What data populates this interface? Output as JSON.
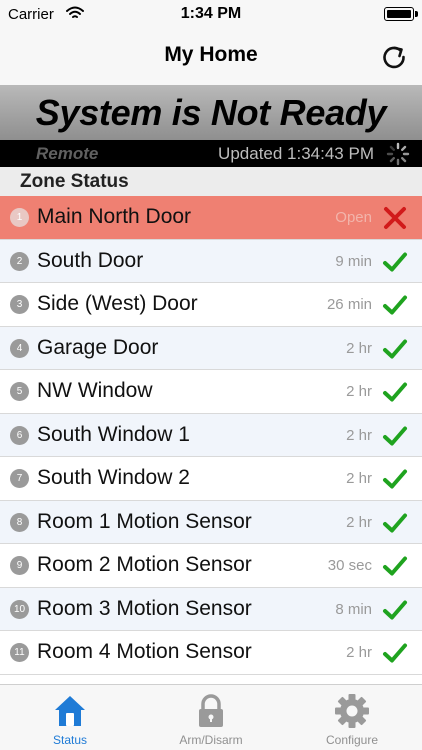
{
  "status_bar": {
    "carrier": "Carrier",
    "time": "1:34 PM"
  },
  "nav": {
    "title": "My Home",
    "refresh_icon": "refresh-icon"
  },
  "banner": {
    "text": "System is Not Ready",
    "color": "#000000"
  },
  "info": {
    "mode": "Remote",
    "updated": "Updated 1:34:43 PM"
  },
  "section": {
    "title": "Zone Status"
  },
  "zones": [
    {
      "num": "1",
      "name": "Main North Door",
      "time": "Open",
      "state": "alarm"
    },
    {
      "num": "2",
      "name": "South Door",
      "time": "9 min",
      "state": "ok"
    },
    {
      "num": "3",
      "name": "Side (West) Door",
      "time": "26 min",
      "state": "ok"
    },
    {
      "num": "4",
      "name": "Garage Door",
      "time": "2 hr",
      "state": "ok"
    },
    {
      "num": "5",
      "name": "NW Window",
      "time": "2 hr",
      "state": "ok"
    },
    {
      "num": "6",
      "name": "South Window 1",
      "time": "2 hr",
      "state": "ok"
    },
    {
      "num": "7",
      "name": "South Window 2",
      "time": "2 hr",
      "state": "ok"
    },
    {
      "num": "8",
      "name": "Room 1 Motion Sensor",
      "time": "2 hr",
      "state": "ok"
    },
    {
      "num": "9",
      "name": "Room 2 Motion Sensor",
      "time": "30 sec",
      "state": "ok"
    },
    {
      "num": "10",
      "name": "Room 3 Motion Sensor",
      "time": "8 min",
      "state": "ok"
    },
    {
      "num": "11",
      "name": "Room 4 Motion Sensor",
      "time": "2 hr",
      "state": "ok"
    }
  ],
  "tabs": [
    {
      "label": "Status",
      "icon": "home-icon",
      "active": true
    },
    {
      "label": "Arm/Disarm",
      "icon": "lock-icon",
      "active": false
    },
    {
      "label": "Configure",
      "icon": "gear-icon",
      "active": false
    }
  ],
  "colors": {
    "alarm_row": "#ef8072",
    "ok_check": "#1fa31f",
    "alarm_x": "#d11a1a",
    "tab_active": "#1f7bd6"
  }
}
